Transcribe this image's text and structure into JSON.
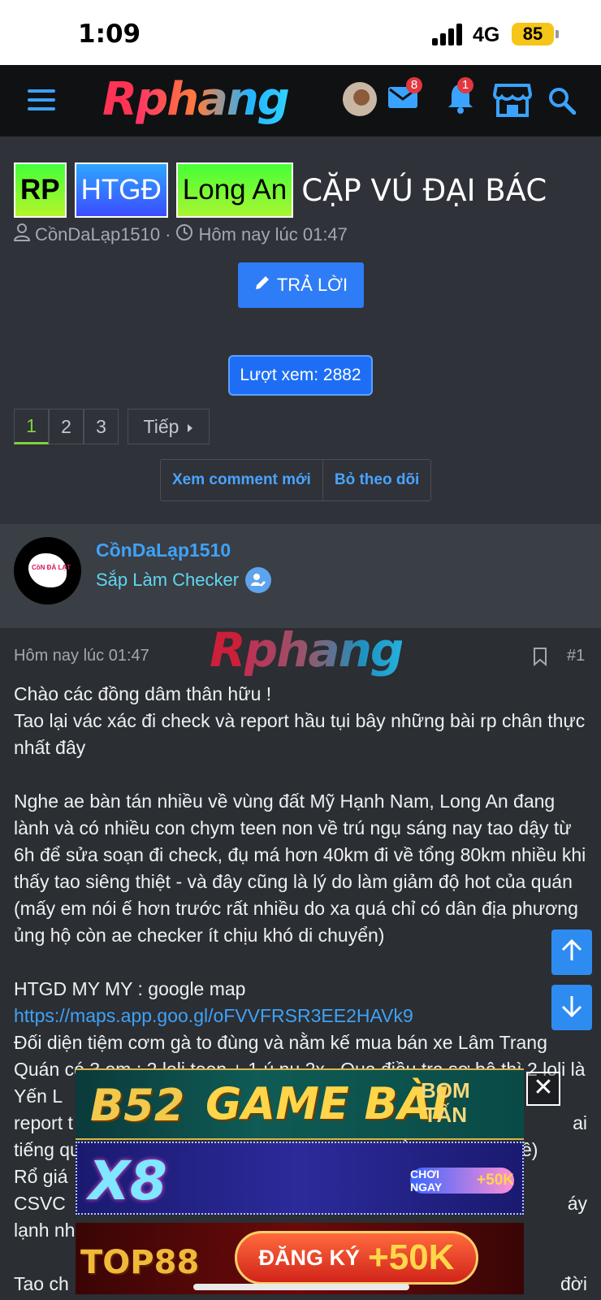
{
  "status_bar": {
    "time": "1:09",
    "network": "4G",
    "battery": "85"
  },
  "header": {
    "logo_part1": "R",
    "logo_part2": "phang",
    "icons": [
      "menu-icon",
      "mail-icon",
      "bell-icon",
      "store-icon",
      "search-icon"
    ],
    "mail_count": "8",
    "alert_count": "1"
  },
  "thread": {
    "prefixes": [
      "RP",
      "HTGĐ",
      "Long An"
    ],
    "title": "CẶP VÚ ĐẠI BÁC",
    "author": "CồnDaLạp1510",
    "separator": "·",
    "date": "Hôm nay lúc 01:47",
    "reply_label": "TRẢ LỜI",
    "views_label": "Lượt xem: 2882",
    "pages": [
      "1",
      "2",
      "3"
    ],
    "active_page": "1",
    "next_label": "Tiếp",
    "new_comments_label": "Xem comment mới",
    "unfollow_label": "Bỏ theo dõi"
  },
  "post_author": {
    "name": "CồnDaLạp1510",
    "rank": "Sắp Làm Checker",
    "avatar_text": "CồN ĐÀ LẠT"
  },
  "post": {
    "date": "Hôm nay lúc 01:47",
    "number": "#1",
    "watermark_part1": "R",
    "watermark_part2": "phang",
    "para1": "Chào các đồng dâm thân hữu !\nTao lại vác xác đi check và report hầu tụi bây những bài rp chân thực nhất đây",
    "para2": "Nghe ae bàn tán nhiều về vùng đất Mỹ Hạnh Nam, Long An đang lành và có nhiều con chym teen non về trú ngụ sáng nay tao dậy từ 6h để sửa soạn đi check, đụ má hơn 40km đi về tổng 80km nhiều khi thấy tao siêng thiệt - và đây cũng là lý do làm giảm độ hot của quán (mấy em nói ế hơn trước rất nhiều do xa quá chỉ có dân địa phương ủng hộ còn ae checker ít chịu khó di chuyển)",
    "shop_line": "HTGD MY MY : google map",
    "map_link": "https://maps.app.goo.gl/oFVVFRSR3EE2HAVk9",
    "para3": "Đối diện tiệm cơm gà to đùng và nằm kế mua bán xe Lâm Trang Quán có 3 em : 2 loli teen + 1 ú nụ 2x . Qua điều tra sơ bộ thì 2 loli là Yến L",
    "line_report": "report t",
    "line_report_end": "ai",
    "line_tieng": "tiếng quán mà mất công so check xong đem thằm cái trước về)",
    "line_ro": "Rổ giá",
    "line_csvc": "CSVC",
    "line_csvc_end": "áy",
    "line_lanh": "lạnh nh",
    "line_tao": "Tao ch",
    "line_tao_end": "đời"
  },
  "ads": {
    "ad1_brand": "B52",
    "ad1_title": "GAME BÀI",
    "ad1_tag_line1": "BOM",
    "ad1_tag_line2": "TẤN",
    "ad2_brand": "X8",
    "ad2_cta": "CHƠI NGAY",
    "ad2_bonus": "+50K",
    "ad3_brand": "TOP88",
    "ad3_cta": "ĐĂNG KÝ",
    "ad3_bonus": "+50K",
    "close_label": "✕"
  },
  "colors": {
    "accent": "#2e7cf6",
    "link": "#3fa2f7",
    "active_page": "#7fd13b",
    "badge": "#e0383e"
  }
}
